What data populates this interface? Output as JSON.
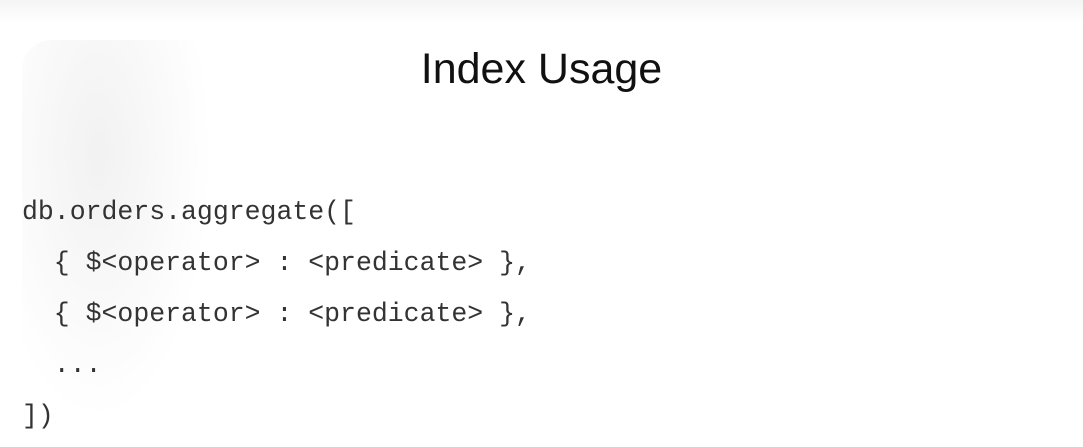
{
  "slide": {
    "title": "Index Usage",
    "code_lines": [
      "db.orders.aggregate([",
      "  { $<operator> : <predicate> },",
      "  { $<operator> : <predicate> },",
      "  ...",
      "])"
    ]
  }
}
